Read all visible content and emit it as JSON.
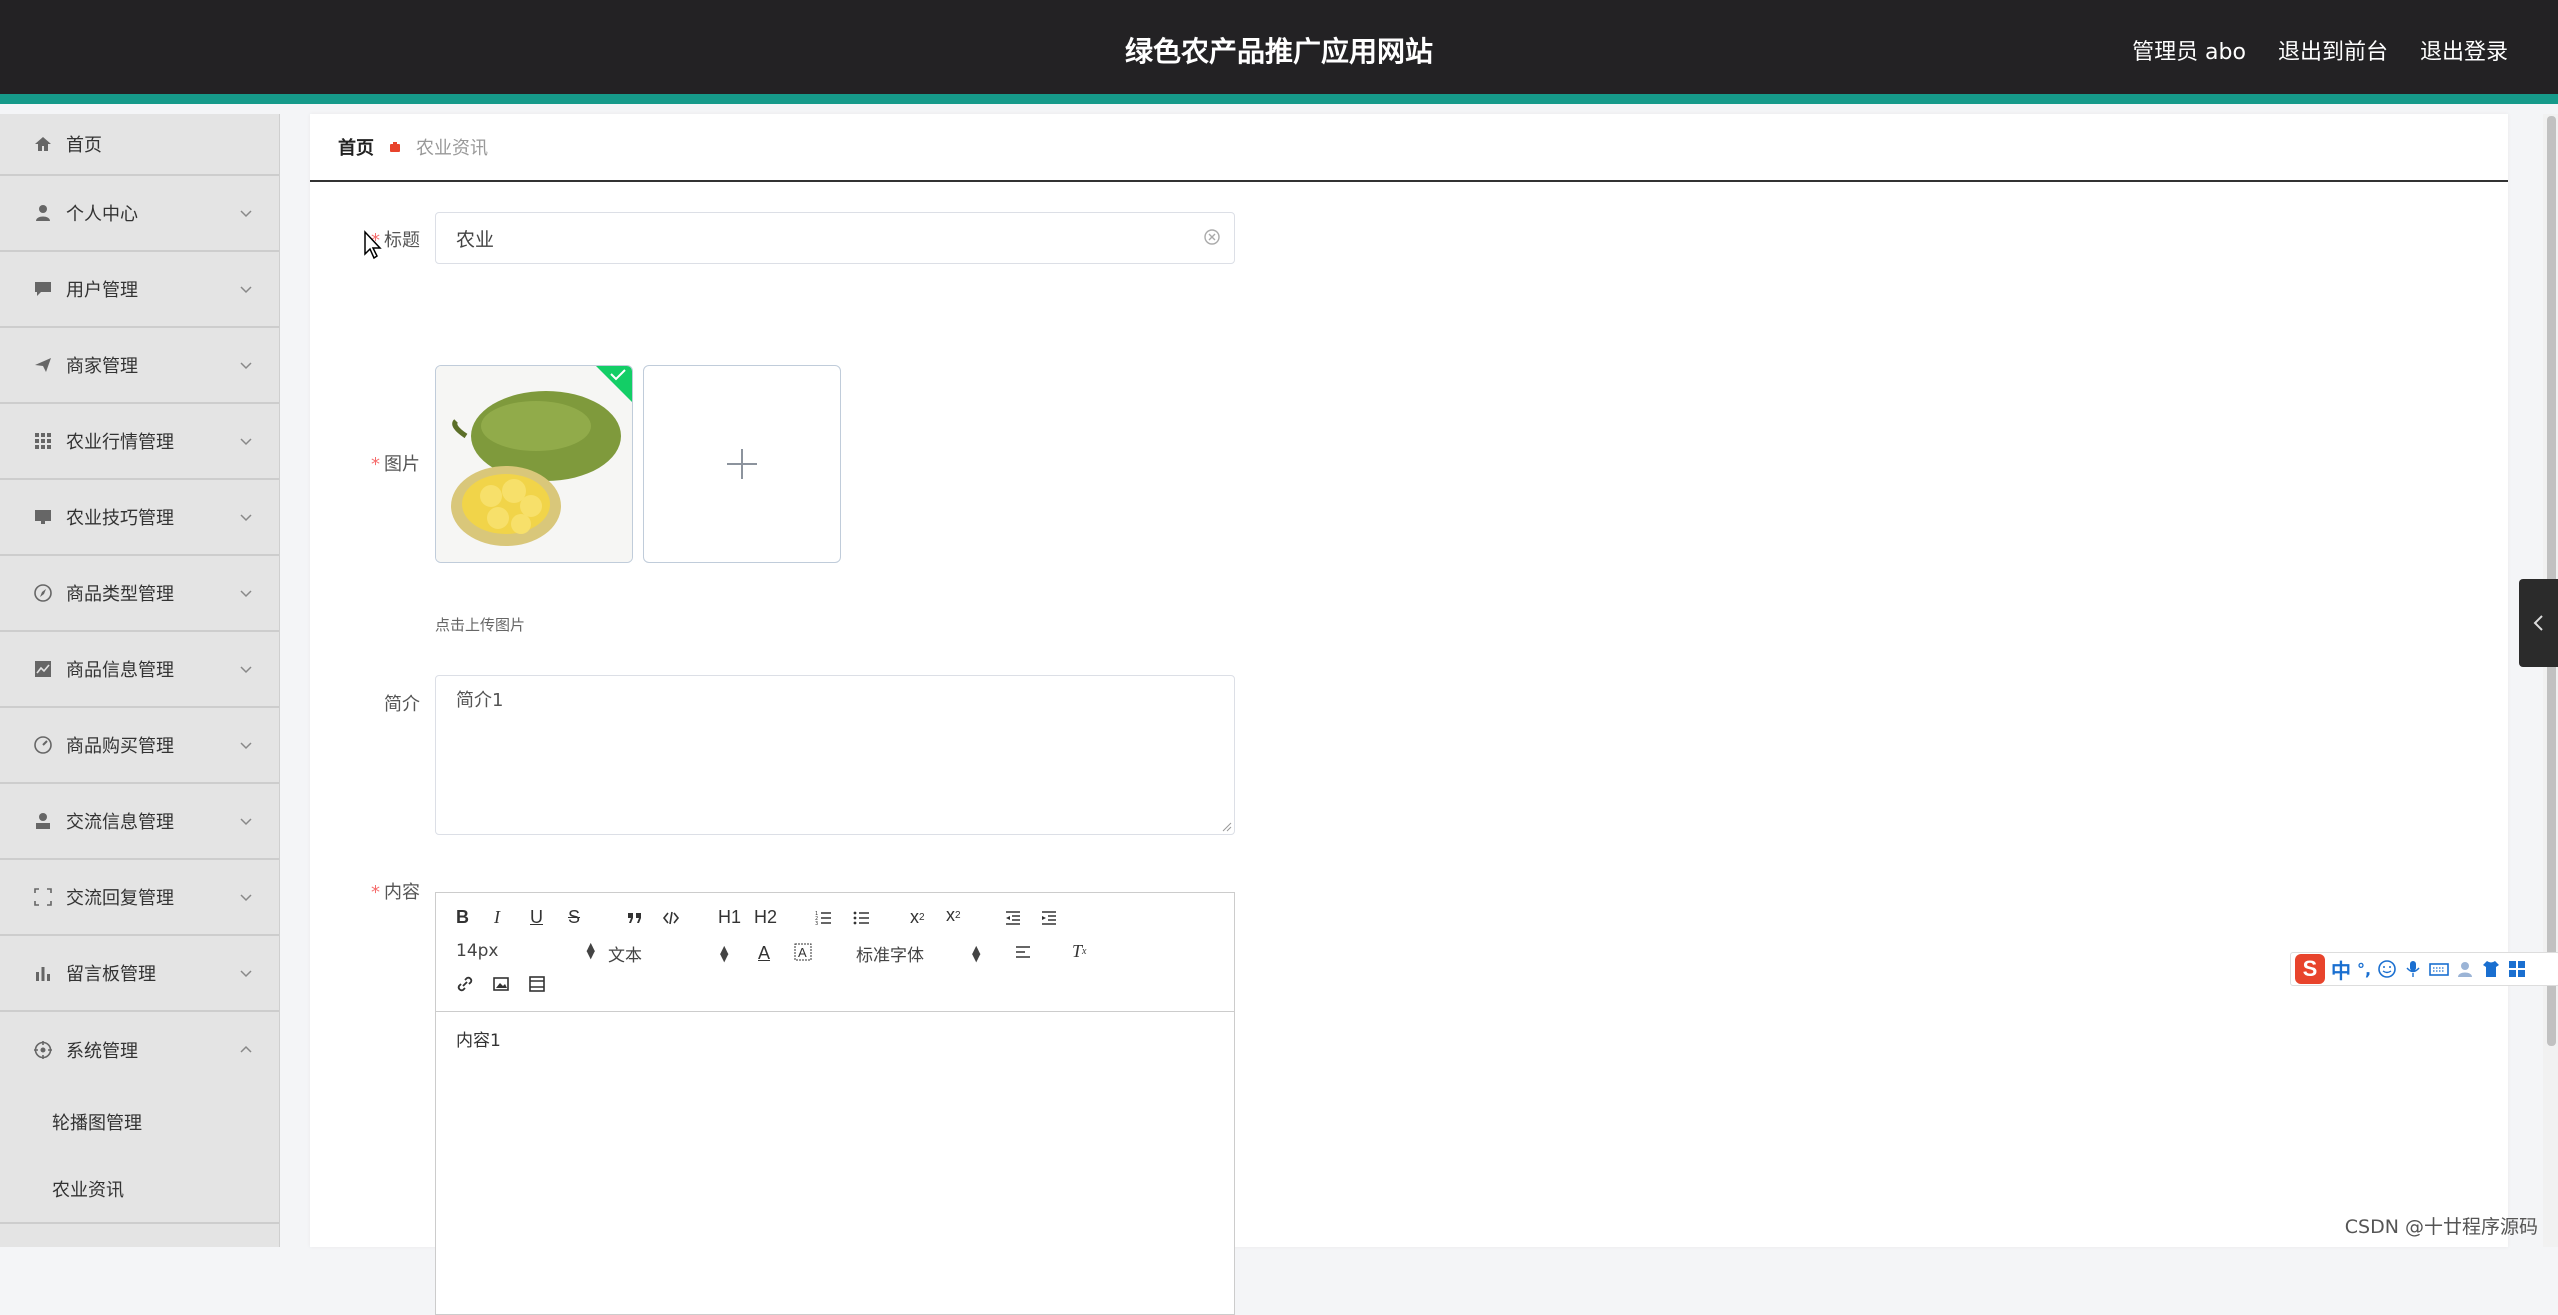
{
  "header": {
    "title": "绿色农产品推广应用网站",
    "user": "管理员 abo",
    "to_frontend": "退出到前台",
    "logout": "退出登录"
  },
  "sidebar": {
    "items": [
      {
        "label": "首页",
        "icon": "home-icon"
      },
      {
        "label": "个人中心",
        "icon": "user-icon"
      },
      {
        "label": "用户管理",
        "icon": "chat-icon"
      },
      {
        "label": "商家管理",
        "icon": "send-icon"
      },
      {
        "label": "农业行情管理",
        "icon": "grid-icon"
      },
      {
        "label": "农业技巧管理",
        "icon": "monitor-icon"
      },
      {
        "label": "商品类型管理",
        "icon": "compass-icon"
      },
      {
        "label": "商品信息管理",
        "icon": "chart-icon"
      },
      {
        "label": "商品购买管理",
        "icon": "gauge-icon"
      },
      {
        "label": "交流信息管理",
        "icon": "person-icon"
      },
      {
        "label": "交流回复管理",
        "icon": "frame-icon"
      },
      {
        "label": "留言板管理",
        "icon": "bars-icon"
      },
      {
        "label": "系统管理",
        "icon": "settings-icon"
      }
    ],
    "submenu": [
      "轮播图管理",
      "农业资讯"
    ]
  },
  "breadcrumb": {
    "home": "首页",
    "current": "农业资讯"
  },
  "form": {
    "title_label": "标题",
    "title_value": "农业",
    "image_label": "图片",
    "upload_tip": "点击上传图片",
    "intro_label": "简介",
    "intro_value": "简介1",
    "content_label": "内容",
    "content_value": "内容1"
  },
  "editor": {
    "font_size": "14px",
    "header_select": "文本",
    "font_family": "标准字体",
    "h1": "H1",
    "h2": "H2"
  },
  "ime": {
    "zh": "中",
    "punct": "°,"
  },
  "watermark": "CSDN @十廿程序源码",
  "colors": {
    "header_bg": "#232224",
    "accent": "#169a8a",
    "required": "#f56c6c"
  }
}
